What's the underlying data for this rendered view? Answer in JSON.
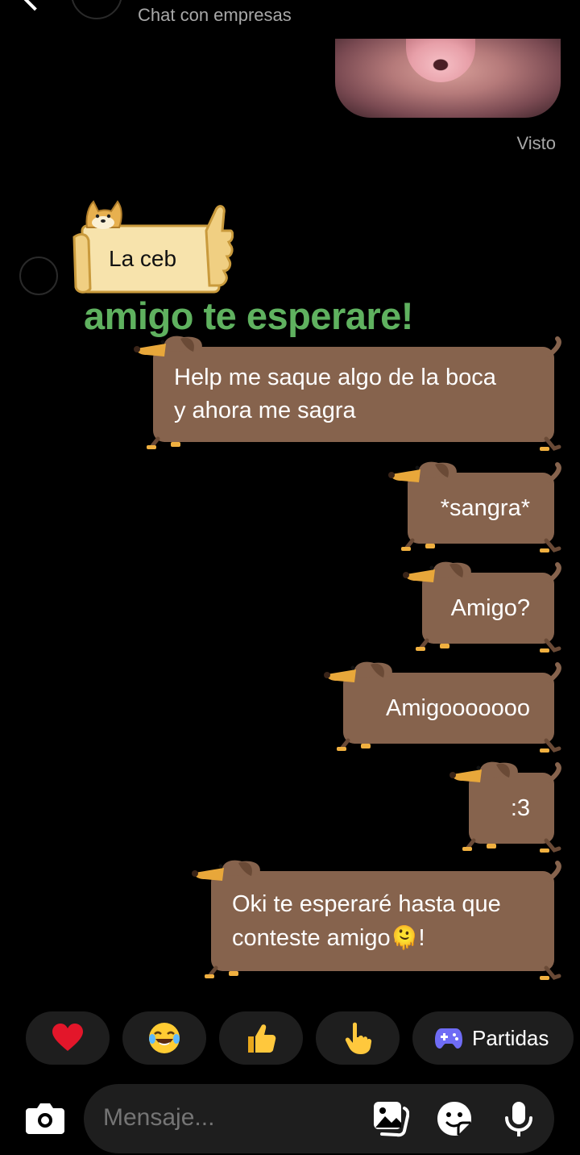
{
  "header": {
    "subtitle": "Chat con empresas"
  },
  "seen_label": "Visto",
  "incoming": {
    "sticker_text": "La ceb",
    "big_text": "amigo te esperare!"
  },
  "messages": [
    {
      "lines": [
        "Help me saque algo de la boca",
        "y ahora me sagra"
      ]
    },
    {
      "lines": [
        "*sangra*"
      ]
    },
    {
      "lines": [
        "Amigo?"
      ]
    },
    {
      "lines": [
        "Amigooooooo"
      ]
    },
    {
      "lines": [
        ":3"
      ]
    },
    {
      "lines": [
        "Oki te esperaré hasta que",
        "conteste amigo"
      ],
      "line2_suffix": "!",
      "emoji": "🫠"
    }
  ],
  "quick_reactions": [
    {
      "icon": "heart-icon",
      "glyph": "❤"
    },
    {
      "icon": "laughing-emoji-icon",
      "glyph": "😂"
    },
    {
      "icon": "thumbs-up-icon",
      "glyph": "👍"
    },
    {
      "icon": "pointing-hand-icon",
      "glyph": "👆"
    }
  ],
  "games_chip": {
    "label": "Partidas",
    "icon": "gamepad-icon"
  },
  "composer": {
    "placeholder": "Mensaje..."
  },
  "colors": {
    "bubble": "#86634d",
    "dog_dark": "#6a4a36",
    "green_text": "#5fb15f",
    "chip_bg": "#1e1e1e",
    "gamepad": "#6f6cf5"
  }
}
